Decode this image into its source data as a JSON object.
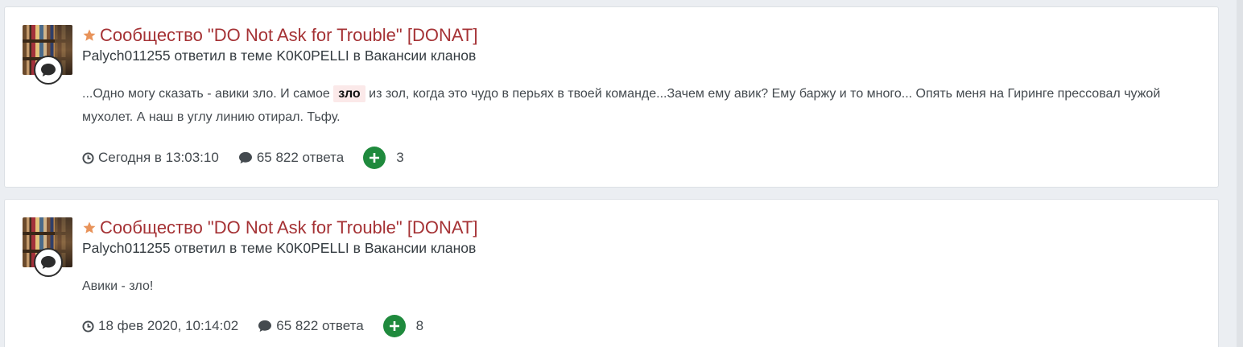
{
  "posts": [
    {
      "title": "Сообщество \"DO Not Ask for Trouble\" [DONAT]",
      "author": "Palych011255",
      "action": " ответил в теме ",
      "topic": "K0K0PELLI",
      "in_word": " в ",
      "forum": "Вакансии кланов",
      "snippet_before": "...Одно могу сказать - авики зло. И самое ",
      "snippet_highlight": "зло",
      "snippet_after": " из зол, когда это чудо в перьях в твоей команде...Зачем ему авик? Ему баржу и то много... Опять меня на Гиринге прессовал чужой мухолет. А наш в углу линию отирал. Тьфу.",
      "date": "Сегодня в 13:03:10",
      "replies": "65 822 ответа",
      "reputation": "3"
    },
    {
      "title": "Сообщество \"DO Not Ask for Trouble\" [DONAT]",
      "author": "Palych011255",
      "action": " ответил в теме ",
      "topic": "K0K0PELLI",
      "in_word": " в ",
      "forum": "Вакансии кланов",
      "snippet_before": "Авики - зло!",
      "date": "18 фев 2020, 10:14:02",
      "replies": "65 822 ответа",
      "reputation": "8"
    }
  ],
  "colors": {
    "title": "#a53235",
    "star": "#e8935a",
    "reputation_badge": "#1f8a3d",
    "highlight_bg": "#fbe9e9"
  },
  "icons": [
    "star-icon",
    "chat-bubble-icon",
    "clock-icon",
    "comment-icon",
    "plus-icon"
  ]
}
